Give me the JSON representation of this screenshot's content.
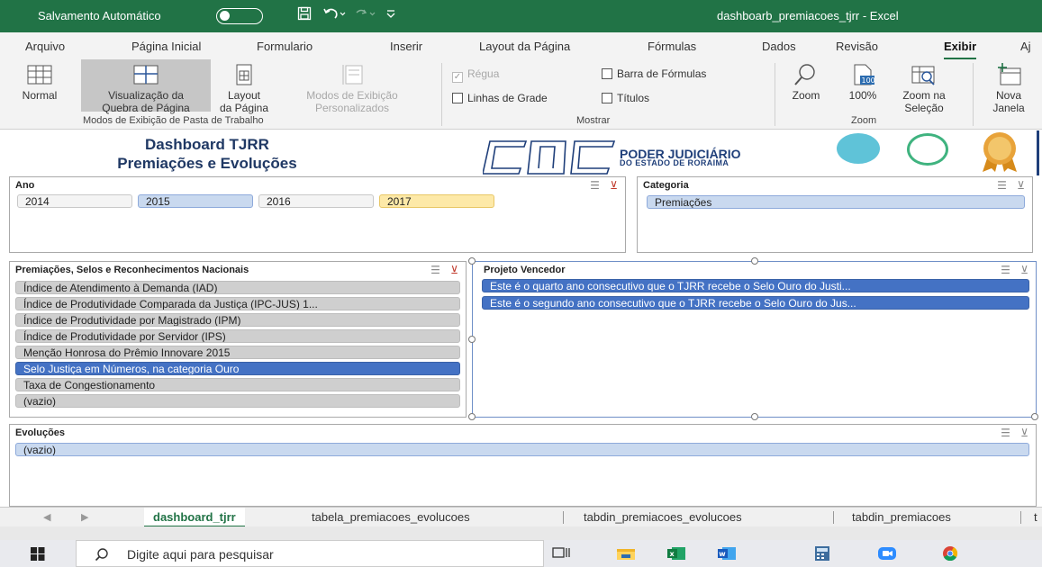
{
  "titlebar": {
    "autosave_label": "Salvamento Automático",
    "document_title": "dashboarb_premiacoes_tjrr  -  Excel",
    "accent": "#217346"
  },
  "ribbon_tabs": [
    "Arquivo",
    "Página Inicial",
    "Formulario",
    "Inserir",
    "Layout da Página",
    "Fórmulas",
    "Dados",
    "Revisão",
    "Exibir",
    "Aj"
  ],
  "active_tab": "Exibir",
  "ribbon": {
    "normal": "Normal",
    "page_break_1": "Visualização da",
    "page_break_2": "Quebra de Página",
    "page_layout_1": "Layout",
    "page_layout_2": "da Página",
    "custom_views_1": "Modos de Exibição",
    "custom_views_2": "Personalizados",
    "group_views": "Modos de Exibição de Pasta de Trabalho",
    "ruler": "Régua",
    "gridlines": "Linhas de Grade",
    "formula_bar": "Barra de Fórmulas",
    "headings": "Títulos",
    "group_show": "Mostrar",
    "zoom": "Zoom",
    "zoom100": "100%",
    "zoom_sel_1": "Zoom na",
    "zoom_sel_2": "Seleção",
    "group_zoom": "Zoom",
    "new_window_1": "Nova",
    "new_window_2": "Janela"
  },
  "banner": {
    "title_line1": "Dashboard TJRR",
    "title_line2": "Premiações e Evoluções",
    "logo_line1": "PODER JUDICIÁRIO",
    "logo_line2": "DO ESTADO DE RORAIMA"
  },
  "slicers": {
    "ano": {
      "title": "Ano",
      "items": [
        "2014",
        "2015",
        "2016",
        "2017"
      ]
    },
    "categoria": {
      "title": "Categoria",
      "items": [
        "Premiações"
      ]
    },
    "premiacoes": {
      "title": "Premiações, Selos e Reconhecimentos Nacionais",
      "items": [
        "Índice de Atendimento à Demanda (IAD)",
        "Índice de Produtividade Comparada da Justiça (IPC-JUS) 1...",
        "Índice de Produtividade por Magistrado (IPM)",
        "Índice de Produtividade por Servidor (IPS)",
        "Menção Honrosa do Prêmio Innovare 2015",
        "Selo Justiça em Números, na categoria Ouro",
        "Taxa de Congestionamento",
        "(vazio)"
      ]
    },
    "projeto": {
      "title": "Projeto Vencedor",
      "items": [
        "Este é o quarto ano consecutivo que o TJRR recebe o Selo Ouro do Justi...",
        "Este é o segundo ano consecutivo que o TJRR recebe o Selo Ouro do Jus..."
      ]
    },
    "evolucoes": {
      "title": "Evoluções",
      "items": [
        "(vazio)"
      ]
    }
  },
  "sheet_tabs": [
    "dashboard_tjrr",
    "tabela_premiacoes_evolucoes",
    "tabdin_premiacoes_evolucoes",
    "tabdin_premiacoes",
    "t"
  ],
  "active_sheet": "dashboard_tjrr",
  "taskbar": {
    "search_placeholder": "Digite aqui para pesquisar"
  },
  "colors": {
    "selected_item": "#4472c4",
    "hover_item": "#fde9a8",
    "available_item": "#c9d9ef"
  }
}
